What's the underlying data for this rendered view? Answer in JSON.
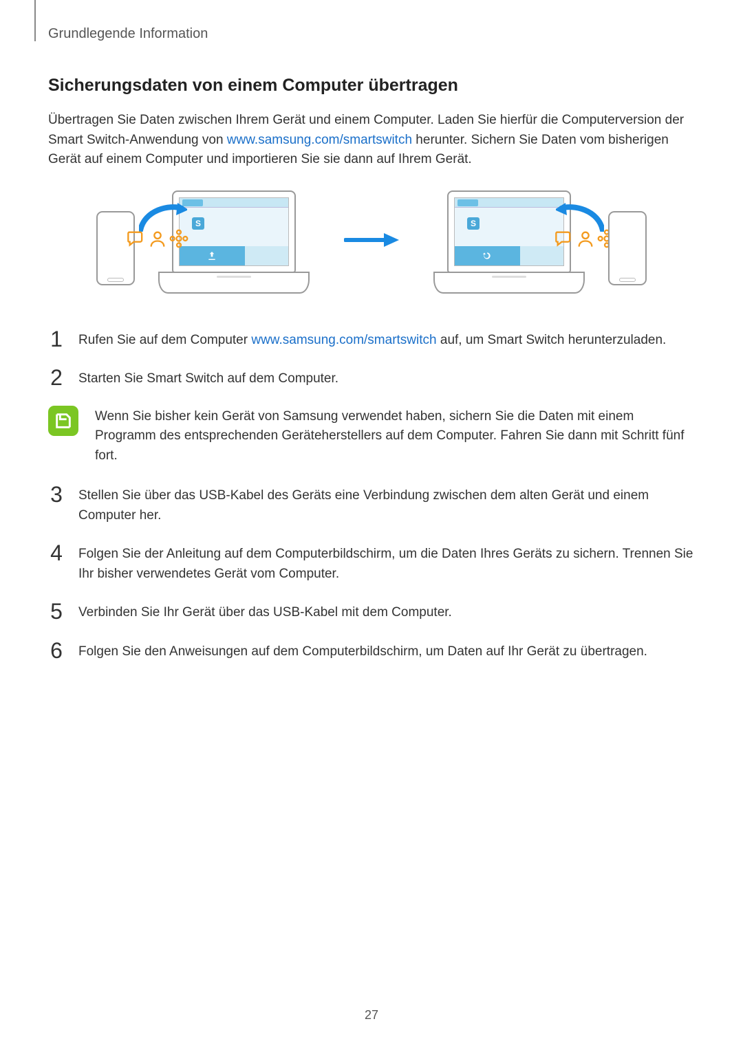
{
  "breadcrumb": "Grundlegende Information",
  "heading": "Sicherungsdaten von einem Computer übertragen",
  "intro_pre": "Übertragen Sie Daten zwischen Ihrem Gerät und einem Computer. Laden Sie hierfür die Computerversion der Smart Switch-Anwendung von ",
  "intro_link": "www.samsung.com/smartswitch",
  "intro_post": " herunter. Sichern Sie Daten vom bisherigen Gerät auf einem Computer und importieren Sie sie dann auf Ihrem Gerät.",
  "illustration_label": "S",
  "steps": {
    "s1_num": "1",
    "s1_pre": "Rufen Sie auf dem Computer ",
    "s1_link": "www.samsung.com/smartswitch",
    "s1_post": " auf, um Smart Switch herunterzuladen.",
    "s2_num": "2",
    "s2_txt": "Starten Sie Smart Switch auf dem Computer.",
    "s3_num": "3",
    "s3_txt": "Stellen Sie über das USB-Kabel des Geräts eine Verbindung zwischen dem alten Gerät und einem Computer her.",
    "s4_num": "4",
    "s4_txt": "Folgen Sie der Anleitung auf dem Computerbildschirm, um die Daten Ihres Geräts zu sichern. Trennen Sie Ihr bisher verwendetes Gerät vom Computer.",
    "s5_num": "5",
    "s5_txt": "Verbinden Sie Ihr Gerät über das USB-Kabel mit dem Computer.",
    "s6_num": "6",
    "s6_txt": "Folgen Sie den Anweisungen auf dem Computerbildschirm, um Daten auf Ihr Gerät zu übertragen."
  },
  "note_text": "Wenn Sie bisher kein Gerät von Samsung verwendet haben, sichern Sie die Daten mit einem Programm des entsprechenden Geräteherstellers auf dem Computer. Fahren Sie dann mit Schritt fünf fort.",
  "page_number": "27"
}
